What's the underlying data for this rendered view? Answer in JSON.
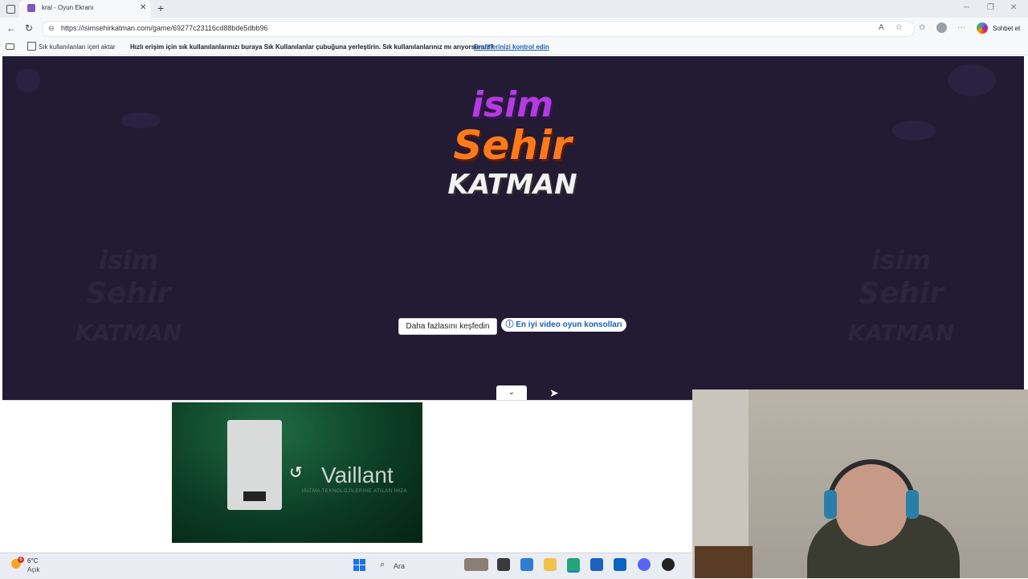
{
  "browser": {
    "tab_title": "kral - Oyun Ekranı",
    "url": "https://isimsehirkatman.com/game/69277c23116cd88bde5dbb96",
    "copilot_label": "Sohbet et"
  },
  "favorites_bar": {
    "import_label": "Sık kullanılanları içeri aktar",
    "message": "Hızlı erişim için sık kullanılanlarınızı buraya Sık Kullanılanlar çubuğuna yerleştirin. Sık kullanılanlarınız mı arıyorsunuz?",
    "link": "Profillerinizi kontrol edin"
  },
  "game": {
    "logo_line1": "isim",
    "logo_line2": "Sehir",
    "logo_line3": "KATMAN",
    "explore_button": "Daha fazlasını keşfedin",
    "consoles_button": "En iyi video oyun konsolları"
  },
  "ad": {
    "brand": "Vaillant",
    "tagline": "ISITMA TEKNOLOJİLERİNE ATILAN İMZA"
  },
  "taskbar": {
    "weather_temp": "6°C",
    "weather_desc": "Açık",
    "weather_badge": "6",
    "search_placeholder": "Ara"
  }
}
